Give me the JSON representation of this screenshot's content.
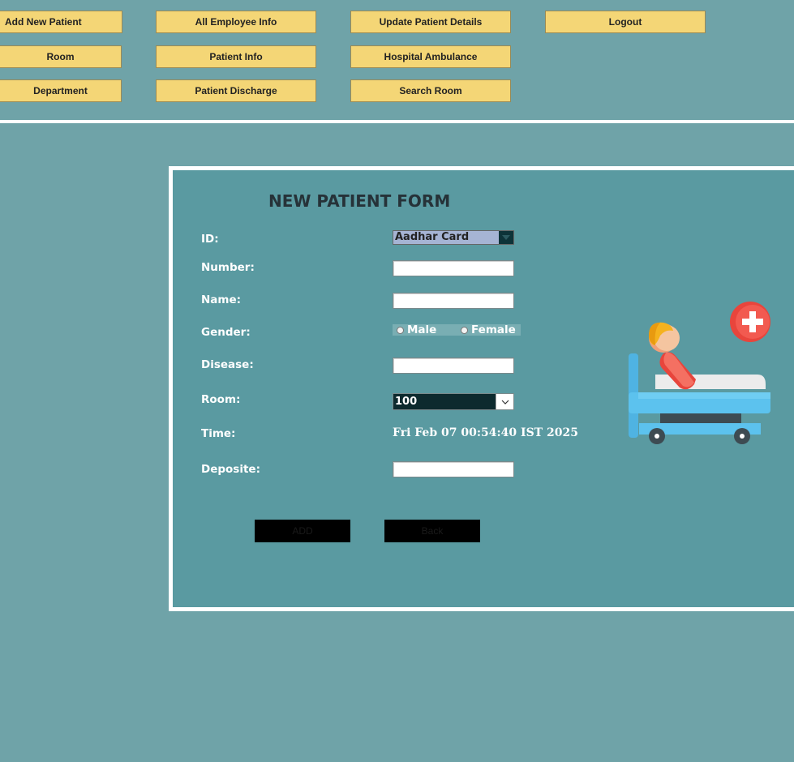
{
  "nav": {
    "add_new_patient": "Add New Patient",
    "all_employee_info": "All Employee Info",
    "update_patient_details": "Update Patient Details",
    "logout": "Logout",
    "room": "Room",
    "patient_info": "Patient Info",
    "hospital_ambulance": "Hospital Ambulance",
    "department": "Department",
    "patient_discharge": "Patient Discharge",
    "search_room": "Search Room"
  },
  "form": {
    "title": "NEW PATIENT FORM",
    "labels": {
      "id": "ID:",
      "number": "Number:",
      "name": "Name:",
      "gender": "Gender:",
      "disease": "Disease:",
      "room": "Room:",
      "time": "Time:",
      "deposite": "Deposite:"
    },
    "id_selected": "Aadhar Card",
    "number_value": "",
    "name_value": "",
    "disease_value": "",
    "deposite_value": "",
    "gender_options": {
      "male": "Male",
      "female": "Female"
    },
    "room_selected": "100",
    "time_value": "Fri Feb 07 00:54:40 IST 2025",
    "add_label": "ADD",
    "back_label": "Back"
  },
  "colors": {
    "background": "#6fa3a8",
    "panel": "#5a9aa1",
    "nav_button": "#f4d676",
    "action_button": "#000000"
  },
  "icons": {
    "illustration": "patient-in-hospital-bed-icon",
    "medical_cross": "medical-cross-icon"
  }
}
